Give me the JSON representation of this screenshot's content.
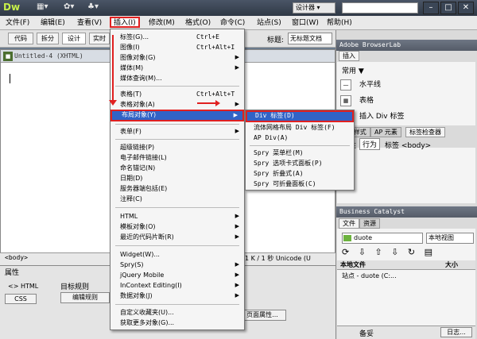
{
  "app": {
    "logo": "Dw",
    "workspace": "设计器 ▾",
    "toolbar_icons": [
      "▦▾",
      "✿▾",
      "♣▾"
    ],
    "window_buttons": [
      "–",
      "□",
      "✕"
    ]
  },
  "menubar": {
    "items": [
      "文件(F)",
      "编辑(E)",
      "查看(V)",
      "插入(I)",
      "修改(M)",
      "格式(O)",
      "命令(C)",
      "站点(S)",
      "窗口(W)",
      "帮助(H)"
    ]
  },
  "doc_toolbar": {
    "buttons": [
      "代码",
      "拆分",
      "设计",
      "实时"
    ],
    "title_label": "标题:",
    "title_value": "无标题文档"
  },
  "document": {
    "tab_title": "Untitled-4 (XHTML)",
    "status_tag": "<body>",
    "status_info": "1 K / 1 秒  Unicode (U"
  },
  "properties": {
    "title": "属性",
    "html_label": "<> HTML",
    "css_label": "CSS",
    "rule_label": "目标规则",
    "edit_rule_label": "编辑规则",
    "page_props_label": "页面属性..."
  },
  "right_panel": {
    "browserlab": "Adobe BrowserLab",
    "insert_tab": "插入",
    "category": "常用 ▼",
    "insert_items": [
      {
        "icon": "—",
        "label": "水平线"
      },
      {
        "icon": "▦",
        "label": "表格"
      },
      {
        "icon": "▭",
        "label": "插入 Div 标签"
      }
    ],
    "css_tabs": [
      "CSS样式",
      "AP 元素",
      "标签检查器"
    ],
    "tag_tabs": [
      "属性",
      "行为",
      "标签 <body>"
    ],
    "business_catalyst": "Business Catalyst",
    "files_tabs": [
      "文件",
      "资源"
    ],
    "site_select": "duote",
    "view_select": "本地视图",
    "file_header_name": "本地文件",
    "file_header_size": "大小",
    "file_row": "站点 - duote (C:...",
    "bottom_label": "备妥",
    "log_button": "日志..."
  },
  "insert_menu": {
    "items": [
      {
        "label": "标签(G)...",
        "shortcut": "Ctrl+E"
      },
      {
        "label": "图像(I)",
        "shortcut": "Ctrl+Alt+I"
      },
      {
        "label": "图像对象(G)",
        "arrow": "▶"
      },
      {
        "label": "媒体(M)",
        "arrow": "▶"
      },
      {
        "label": "媒体查询(M)..."
      },
      {
        "label": "表格(T)",
        "shortcut": "Ctrl+Alt+T"
      },
      {
        "label": "表格对象(A)",
        "arrow": "▶"
      },
      {
        "label": "布局对象(Y)",
        "arrow": "▶"
      },
      {
        "label": "表单(F)",
        "arrow": "▶"
      },
      {
        "label": "超级链接(P)"
      },
      {
        "label": "电子邮件链接(L)"
      },
      {
        "label": "命名锚记(N)"
      },
      {
        "label": "日期(D)"
      },
      {
        "label": "服务器端包括(E)"
      },
      {
        "label": "注释(C)"
      },
      {
        "label": "HTML",
        "arrow": "▶"
      },
      {
        "label": "模板对象(O)",
        "arrow": "▶"
      },
      {
        "label": "最近的代码片断(R)",
        "arrow": "▶"
      },
      {
        "label": "Widget(W)..."
      },
      {
        "label": "Spry(S)",
        "arrow": "▶"
      },
      {
        "label": "jQuery Mobile",
        "arrow": "▶"
      },
      {
        "label": "InContext Editing(I)",
        "arrow": "▶"
      },
      {
        "label": "数据对象(J)",
        "arrow": "▶"
      },
      {
        "label": "自定义收藏夹(U)..."
      },
      {
        "label": "获取更多对象(G)..."
      }
    ]
  },
  "layout_submenu": {
    "items": [
      "Div 标签(D)",
      "流体网格布局 Div 标签(F)",
      "AP Div(A)",
      "Spry 菜单栏(M)",
      "Spry 选项卡式面板(P)",
      "Spry 折叠式(A)",
      "Spry 可折叠面板(C)"
    ]
  }
}
